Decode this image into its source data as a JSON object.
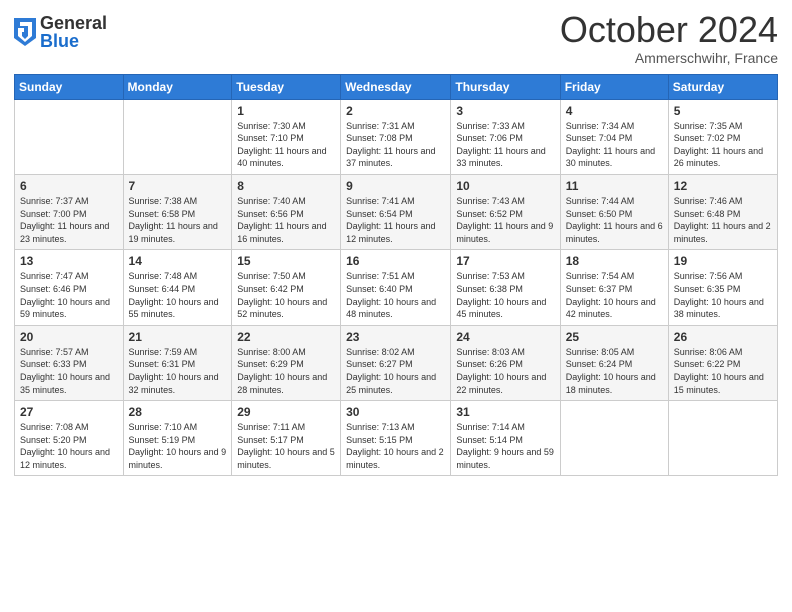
{
  "header": {
    "logo": {
      "line1": "General",
      "line2": "Blue"
    },
    "month": "October 2024",
    "location": "Ammerschwihr, France"
  },
  "columns": [
    "Sunday",
    "Monday",
    "Tuesday",
    "Wednesday",
    "Thursday",
    "Friday",
    "Saturday"
  ],
  "weeks": [
    [
      {
        "day": "",
        "info": ""
      },
      {
        "day": "",
        "info": ""
      },
      {
        "day": "1",
        "info": "Sunrise: 7:30 AM\nSunset: 7:10 PM\nDaylight: 11 hours and 40 minutes."
      },
      {
        "day": "2",
        "info": "Sunrise: 7:31 AM\nSunset: 7:08 PM\nDaylight: 11 hours and 37 minutes."
      },
      {
        "day": "3",
        "info": "Sunrise: 7:33 AM\nSunset: 7:06 PM\nDaylight: 11 hours and 33 minutes."
      },
      {
        "day": "4",
        "info": "Sunrise: 7:34 AM\nSunset: 7:04 PM\nDaylight: 11 hours and 30 minutes."
      },
      {
        "day": "5",
        "info": "Sunrise: 7:35 AM\nSunset: 7:02 PM\nDaylight: 11 hours and 26 minutes."
      }
    ],
    [
      {
        "day": "6",
        "info": "Sunrise: 7:37 AM\nSunset: 7:00 PM\nDaylight: 11 hours and 23 minutes."
      },
      {
        "day": "7",
        "info": "Sunrise: 7:38 AM\nSunset: 6:58 PM\nDaylight: 11 hours and 19 minutes."
      },
      {
        "day": "8",
        "info": "Sunrise: 7:40 AM\nSunset: 6:56 PM\nDaylight: 11 hours and 16 minutes."
      },
      {
        "day": "9",
        "info": "Sunrise: 7:41 AM\nSunset: 6:54 PM\nDaylight: 11 hours and 12 minutes."
      },
      {
        "day": "10",
        "info": "Sunrise: 7:43 AM\nSunset: 6:52 PM\nDaylight: 11 hours and 9 minutes."
      },
      {
        "day": "11",
        "info": "Sunrise: 7:44 AM\nSunset: 6:50 PM\nDaylight: 11 hours and 6 minutes."
      },
      {
        "day": "12",
        "info": "Sunrise: 7:46 AM\nSunset: 6:48 PM\nDaylight: 11 hours and 2 minutes."
      }
    ],
    [
      {
        "day": "13",
        "info": "Sunrise: 7:47 AM\nSunset: 6:46 PM\nDaylight: 10 hours and 59 minutes."
      },
      {
        "day": "14",
        "info": "Sunrise: 7:48 AM\nSunset: 6:44 PM\nDaylight: 10 hours and 55 minutes."
      },
      {
        "day": "15",
        "info": "Sunrise: 7:50 AM\nSunset: 6:42 PM\nDaylight: 10 hours and 52 minutes."
      },
      {
        "day": "16",
        "info": "Sunrise: 7:51 AM\nSunset: 6:40 PM\nDaylight: 10 hours and 48 minutes."
      },
      {
        "day": "17",
        "info": "Sunrise: 7:53 AM\nSunset: 6:38 PM\nDaylight: 10 hours and 45 minutes."
      },
      {
        "day": "18",
        "info": "Sunrise: 7:54 AM\nSunset: 6:37 PM\nDaylight: 10 hours and 42 minutes."
      },
      {
        "day": "19",
        "info": "Sunrise: 7:56 AM\nSunset: 6:35 PM\nDaylight: 10 hours and 38 minutes."
      }
    ],
    [
      {
        "day": "20",
        "info": "Sunrise: 7:57 AM\nSunset: 6:33 PM\nDaylight: 10 hours and 35 minutes."
      },
      {
        "day": "21",
        "info": "Sunrise: 7:59 AM\nSunset: 6:31 PM\nDaylight: 10 hours and 32 minutes."
      },
      {
        "day": "22",
        "info": "Sunrise: 8:00 AM\nSunset: 6:29 PM\nDaylight: 10 hours and 28 minutes."
      },
      {
        "day": "23",
        "info": "Sunrise: 8:02 AM\nSunset: 6:27 PM\nDaylight: 10 hours and 25 minutes."
      },
      {
        "day": "24",
        "info": "Sunrise: 8:03 AM\nSunset: 6:26 PM\nDaylight: 10 hours and 22 minutes."
      },
      {
        "day": "25",
        "info": "Sunrise: 8:05 AM\nSunset: 6:24 PM\nDaylight: 10 hours and 18 minutes."
      },
      {
        "day": "26",
        "info": "Sunrise: 8:06 AM\nSunset: 6:22 PM\nDaylight: 10 hours and 15 minutes."
      }
    ],
    [
      {
        "day": "27",
        "info": "Sunrise: 7:08 AM\nSunset: 5:20 PM\nDaylight: 10 hours and 12 minutes."
      },
      {
        "day": "28",
        "info": "Sunrise: 7:10 AM\nSunset: 5:19 PM\nDaylight: 10 hours and 9 minutes."
      },
      {
        "day": "29",
        "info": "Sunrise: 7:11 AM\nSunset: 5:17 PM\nDaylight: 10 hours and 5 minutes."
      },
      {
        "day": "30",
        "info": "Sunrise: 7:13 AM\nSunset: 5:15 PM\nDaylight: 10 hours and 2 minutes."
      },
      {
        "day": "31",
        "info": "Sunrise: 7:14 AM\nSunset: 5:14 PM\nDaylight: 9 hours and 59 minutes."
      },
      {
        "day": "",
        "info": ""
      },
      {
        "day": "",
        "info": ""
      }
    ]
  ]
}
